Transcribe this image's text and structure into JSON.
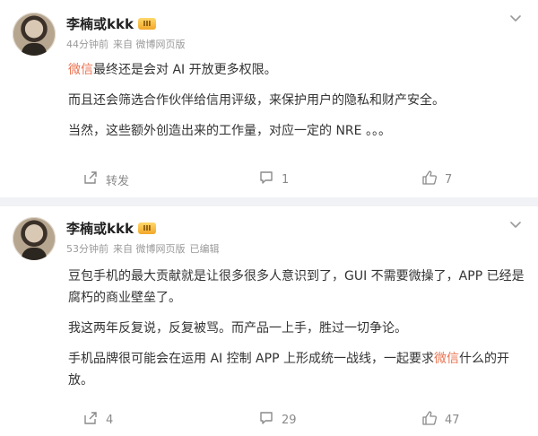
{
  "posts": [
    {
      "username": "李楠或kkk",
      "badge": "III",
      "time": "44分钟前",
      "source": "来自 微博网页版",
      "edited": "",
      "paragraphs": [
        {
          "pre": "",
          "accent": "微信",
          "post": "最终还是会对 AI 开放更多权限。"
        },
        {
          "pre": "而且还会筛选合作伙伴给信用评级，来保护用户的隐私和财产安全。",
          "accent": "",
          "post": ""
        },
        {
          "pre": "当然，这些额外创造出来的工作量，对应一定的 NRE 。。。",
          "accent": "",
          "post": ""
        }
      ],
      "actions": {
        "repost": "转发",
        "comments": "1",
        "likes": "7"
      }
    },
    {
      "username": "李楠或kkk",
      "badge": "III",
      "time": "53分钟前",
      "source": "来自 微博网页版",
      "edited": "已编辑",
      "paragraphs": [
        {
          "pre": "豆包手机的最大贡献就是让很多很多人意识到了，GUI 不需要微操了，APP 已经是腐朽的商业壁垒了。",
          "accent": "",
          "post": ""
        },
        {
          "pre": "我这两年反复说，反复被骂。而产品一上手，胜过一切争论。",
          "accent": "",
          "post": ""
        },
        {
          "pre": "手机品牌很可能会在运用 AI 控制 APP 上形成统一战线，一起要求",
          "accent": "微信",
          "post": "什么的开放。"
        }
      ],
      "actions": {
        "repost": "4",
        "comments": "29",
        "likes": "47"
      }
    }
  ],
  "colors": {
    "accent": "#eb7350",
    "muted": "#9a9a9a",
    "background": "#f1f2f5"
  },
  "icons": [
    "chevron-down-icon",
    "repost-icon",
    "comment-icon",
    "like-icon"
  ]
}
